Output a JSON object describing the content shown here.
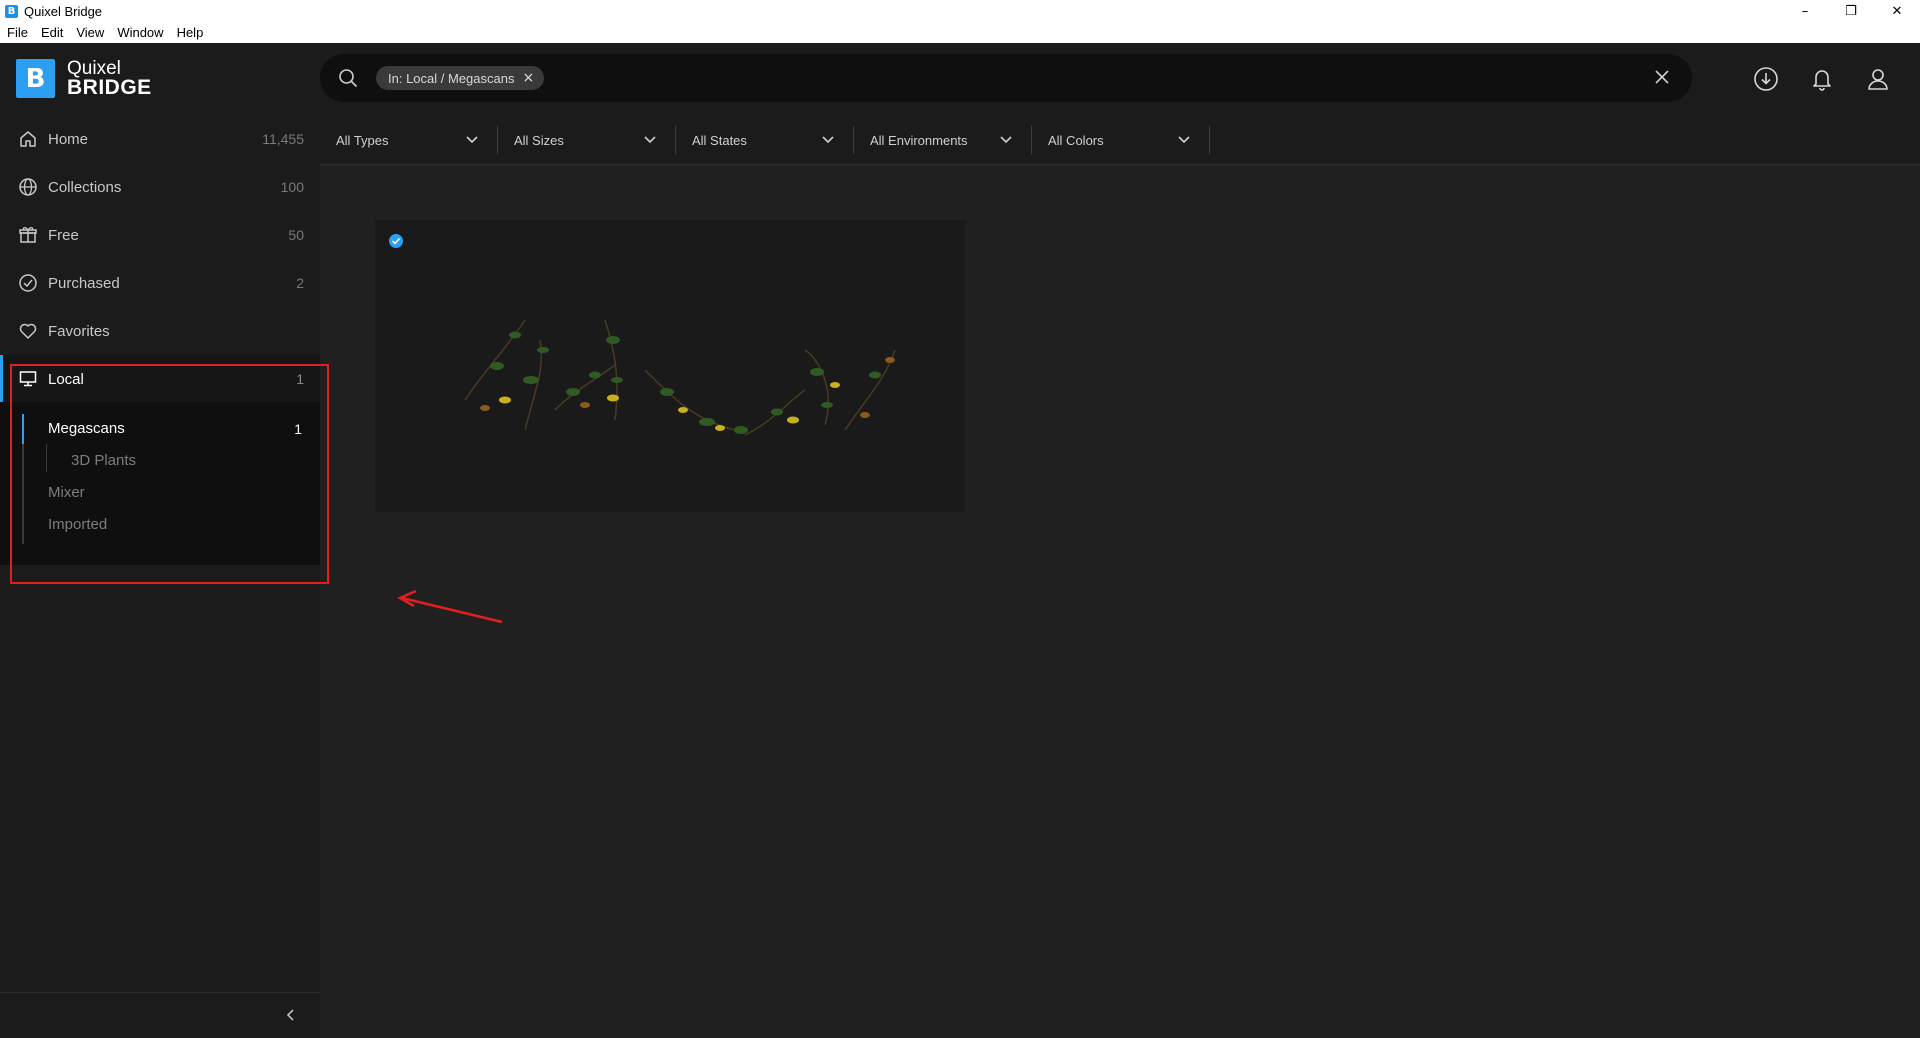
{
  "window": {
    "title": "Quixel Bridge",
    "app_icon_letter": "B",
    "controls": [
      "–",
      "❐",
      "✕"
    ]
  },
  "menu": {
    "items": [
      "File",
      "Edit",
      "View",
      "Window",
      "Help"
    ]
  },
  "header": {
    "logo_mark": "B",
    "logo_line1": "Quixel",
    "logo_line2": "BRIDGE",
    "search": {
      "chip_label": "In: Local / Megascans",
      "chip_close": "×",
      "placeholder": ""
    },
    "icons": [
      "download-icon",
      "notification-bell-icon",
      "user-account-icon"
    ]
  },
  "sidebar": {
    "items": [
      {
        "label": "Home",
        "count": "11,455",
        "icon": "home-icon"
      },
      {
        "label": "Collections",
        "count": "100",
        "icon": "globe-icon"
      },
      {
        "label": "Free",
        "count": "50",
        "icon": "gift-icon"
      },
      {
        "label": "Purchased",
        "count": "2",
        "icon": "check-circle-icon"
      },
      {
        "label": "Favorites",
        "count": "",
        "icon": "heart-icon"
      },
      {
        "label": "Local",
        "count": "1",
        "icon": "monitor-icon",
        "active": true
      }
    ],
    "local_sub": {
      "megascans": {
        "label": "Megascans",
        "count": "1"
      },
      "plants": {
        "label": "3D Plants"
      },
      "mixer": {
        "label": "Mixer"
      },
      "imported": {
        "label": "Imported"
      }
    }
  },
  "filters": [
    {
      "label": "All Types"
    },
    {
      "label": "All Sizes"
    },
    {
      "label": "All States"
    },
    {
      "label": "All Environments"
    },
    {
      "label": "All Colors"
    }
  ],
  "colors": {
    "accent": "#2d9ff3",
    "annotation": "#e02020",
    "background": "#202020",
    "sidebar": "#1b1b1b"
  },
  "asset": {
    "status_icon": "downloaded-check-icon",
    "preview": "3D Plants asset thumbnail"
  }
}
